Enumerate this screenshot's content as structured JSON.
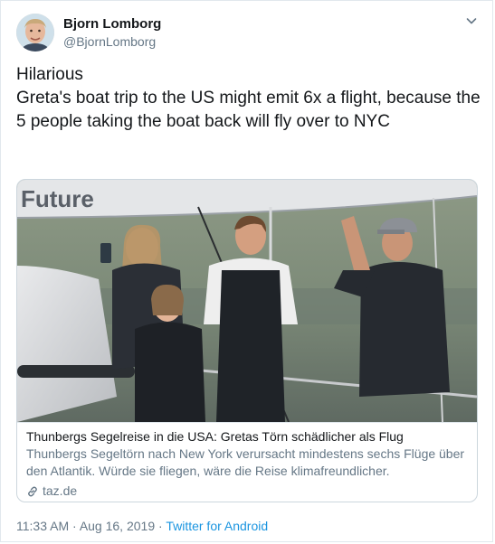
{
  "author": {
    "name": "Bjorn Lomborg",
    "handle": "@BjornLomborg"
  },
  "tweet": {
    "text": "Hilarious\nGreta's boat trip to the US might emit 6x a flight, because the 5 people taking the boat back will fly over to NYC"
  },
  "card": {
    "sail_text": "Future",
    "title": "Thunbergs Segelreise in die USA: Gretas Törn schädlicher als Flug",
    "description": "Thunbergs Segeltörn nach New York verursacht mindestens sechs Flüge über den Atlantik. Würde sie fliegen, wäre die Reise klimafreundlicher.",
    "domain": "taz.de"
  },
  "footer": {
    "time": "11:33 AM",
    "separator": "·",
    "date": "Aug 16, 2019",
    "source": "Twitter for Android"
  },
  "icons": {
    "caret": "chevron-down-icon",
    "link": "link-icon"
  },
  "colors": {
    "link": "#1b95e0",
    "secondary_text": "#657786",
    "border": "#ccd6dd"
  }
}
